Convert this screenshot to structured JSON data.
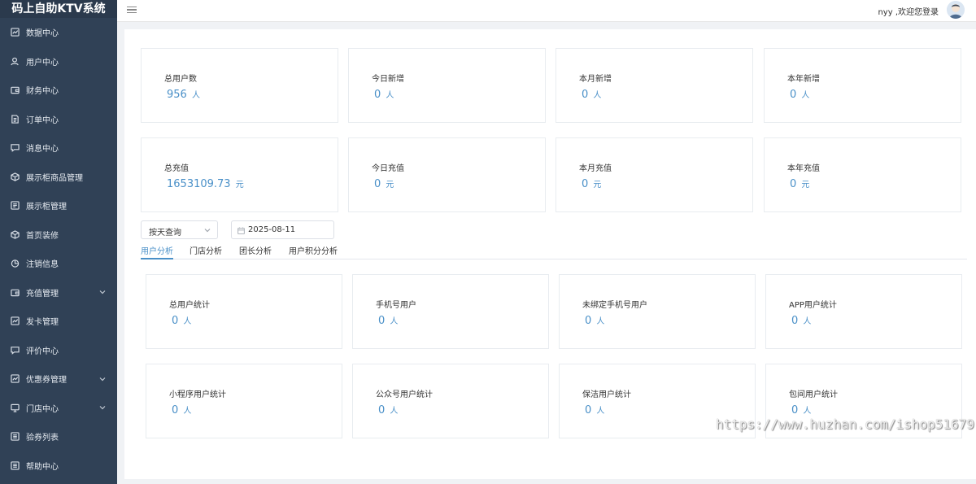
{
  "app": {
    "title": "码上自助KTV系统"
  },
  "sidebar": {
    "items": [
      {
        "label": "数据中心",
        "icon": "chart-icon",
        "expandable": false
      },
      {
        "label": "用户中心",
        "icon": "user-icon",
        "expandable": false
      },
      {
        "label": "财务中心",
        "icon": "wallet-icon",
        "expandable": false
      },
      {
        "label": "订单中心",
        "icon": "document-icon",
        "expandable": false
      },
      {
        "label": "消息中心",
        "icon": "message-icon",
        "expandable": false
      },
      {
        "label": "展示柜商品管理",
        "icon": "box-icon",
        "expandable": false
      },
      {
        "label": "展示柜管理",
        "icon": "cabinet-icon",
        "expandable": false
      },
      {
        "label": "首页装修",
        "icon": "box-icon",
        "expandable": false
      },
      {
        "label": "注销信息",
        "icon": "pie-icon",
        "expandable": false
      },
      {
        "label": "充值管理",
        "icon": "wallet-icon",
        "expandable": true
      },
      {
        "label": "发卡管理",
        "icon": "chart-icon",
        "expandable": false
      },
      {
        "label": "评价中心",
        "icon": "message-icon",
        "expandable": false
      },
      {
        "label": "优惠券管理",
        "icon": "chart-icon",
        "expandable": true
      },
      {
        "label": "门店中心",
        "icon": "monitor-icon",
        "expandable": true
      },
      {
        "label": "验券列表",
        "icon": "list-icon",
        "expandable": false
      },
      {
        "label": "帮助中心",
        "icon": "list-icon",
        "expandable": false
      }
    ]
  },
  "header": {
    "welcome": "nyy ,欢迎您登录"
  },
  "stats": [
    {
      "label": "总用户数",
      "value": "956",
      "unit": "人"
    },
    {
      "label": "今日新增",
      "value": "0",
      "unit": "人"
    },
    {
      "label": "本月新增",
      "value": "0",
      "unit": "人"
    },
    {
      "label": "本年新增",
      "value": "0",
      "unit": "人"
    },
    {
      "label": "总充值",
      "value": "1653109.73",
      "unit": "元"
    },
    {
      "label": "今日充值",
      "value": "0",
      "unit": "元"
    },
    {
      "label": "本月充值",
      "value": "0",
      "unit": "元"
    },
    {
      "label": "本年充值",
      "value": "0",
      "unit": "元"
    }
  ],
  "filters": {
    "mode": "按天查询",
    "date": "2025-08-11"
  },
  "tabs": [
    {
      "label": "用户分析",
      "active": true
    },
    {
      "label": "门店分析",
      "active": false
    },
    {
      "label": "团长分析",
      "active": false
    },
    {
      "label": "用户积分分析",
      "active": false
    }
  ],
  "analysis": [
    {
      "label": "总用户统计",
      "value": "0",
      "unit": "人"
    },
    {
      "label": "手机号用户",
      "value": "0",
      "unit": "人"
    },
    {
      "label": "未绑定手机号用户",
      "value": "0",
      "unit": "人"
    },
    {
      "label": "APP用户统计",
      "value": "0",
      "unit": "人"
    },
    {
      "label": "小程序用户统计",
      "value": "0",
      "unit": "人"
    },
    {
      "label": "公众号用户统计",
      "value": "0",
      "unit": "人"
    },
    {
      "label": "保洁用户统计",
      "value": "0",
      "unit": "人"
    },
    {
      "label": "包间用户统计",
      "value": "0",
      "unit": "人"
    }
  ],
  "watermark": "https://www.huzhan.com/ishop51679",
  "colors": {
    "sidebar": "#304156",
    "accent": "#4a90c8"
  }
}
